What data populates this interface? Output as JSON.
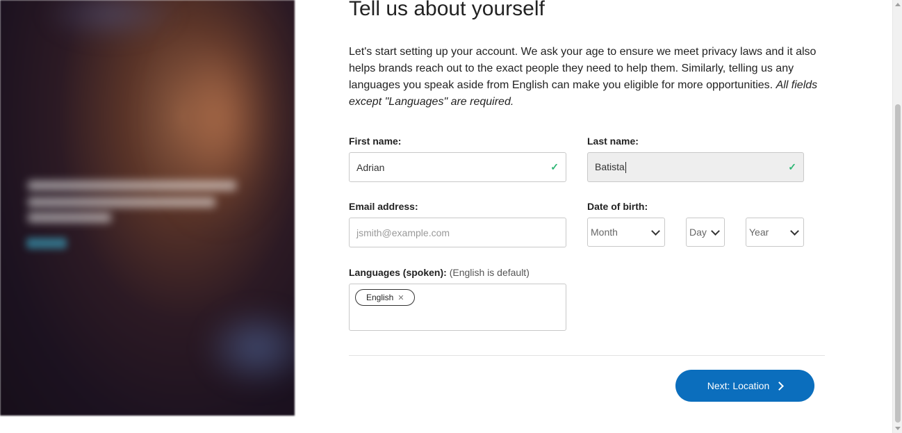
{
  "page": {
    "title": "Tell us about yourself",
    "intro_text": "Let's start setting up your account. We ask your age to ensure we meet privacy laws and it also helps brands reach out to the exact people they need to help them. Similarly, telling us any languages you speak aside from English can make you eligible for more opportunities.",
    "intro_emphasis": "All fields except \"Languages\" are required."
  },
  "form": {
    "first_name": {
      "label": "First name:",
      "value": "Adrian",
      "valid": true
    },
    "last_name": {
      "label": "Last name:",
      "value": "Batista",
      "valid": true
    },
    "email": {
      "label": "Email address:",
      "value": "",
      "placeholder": "jsmith@example.com"
    },
    "dob": {
      "label": "Date of birth:",
      "month": "Month",
      "day": "Day",
      "year": "Year"
    },
    "languages": {
      "label": "Languages (spoken):",
      "hint": "(English is default)",
      "tags": [
        "English"
      ]
    }
  },
  "actions": {
    "next_label": "Next: Location"
  },
  "icons": {
    "valid": "checkmark-icon",
    "remove": "close-icon",
    "next": "chevron-right-icon",
    "select": "chevron-down-icon"
  },
  "colors": {
    "primary": "#0b6ebd",
    "valid": "#2bb673"
  }
}
